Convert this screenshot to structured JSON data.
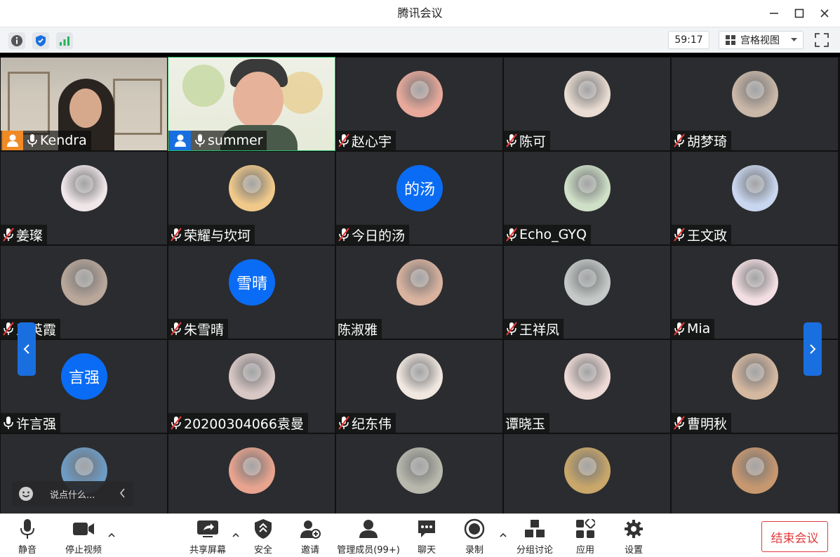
{
  "window": {
    "title": "腾讯会议"
  },
  "infobar": {
    "timer": "59:17",
    "view_mode": "宫格视图"
  },
  "participants": [
    {
      "name": "Kendra",
      "mic": "on",
      "video": true,
      "host": true
    },
    {
      "name": "summer",
      "mic": "on",
      "video": true,
      "cohost": true
    },
    {
      "name": "赵心宇",
      "mic": "muted",
      "avatar_color": "#e8a99a"
    },
    {
      "name": "陈可",
      "mic": "muted",
      "avatar_color": "#e9dcd2"
    },
    {
      "name": "胡梦琦",
      "mic": "muted",
      "avatar_color": "#c9b7a8"
    },
    {
      "name": "姜璨",
      "mic": "muted",
      "avatar_color": "#efe6e8"
    },
    {
      "name": "荣耀与坎坷",
      "mic": "muted",
      "avatar_color": "#f0c98a"
    },
    {
      "name": "今日的汤",
      "mic": "muted",
      "avatar_text": "的汤"
    },
    {
      "name": "Echo_GYQ",
      "mic": "muted",
      "avatar_color": "#cfe0c8"
    },
    {
      "name": "王文政",
      "mic": "muted",
      "avatar_color": "#c8d6ef"
    },
    {
      "name": "王英霞",
      "mic": "muted",
      "avatar_color": "#b9a79a"
    },
    {
      "name": "朱雪晴",
      "mic": "muted",
      "avatar_text": "雪晴"
    },
    {
      "name": "陈淑雅",
      "mic": "none",
      "avatar_color": "#d9b39f"
    },
    {
      "name": "王祥凤",
      "mic": "muted",
      "avatar_color": "#c4c9c7"
    },
    {
      "name": "Mia",
      "mic": "muted",
      "avatar_color": "#f3dfe3"
    },
    {
      "name": "许言强",
      "mic": "on",
      "avatar_text": "言强"
    },
    {
      "name": "20200304066袁曼",
      "mic": "muted",
      "avatar_color": "#d8c8c5"
    },
    {
      "name": "纪东伟",
      "mic": "muted",
      "avatar_color": "#f0e7e0"
    },
    {
      "name": "谭晓玉",
      "mic": "none",
      "avatar_color": "#eddad6"
    },
    {
      "name": "曹明秋",
      "mic": "muted",
      "avatar_color": "#d5b8a0"
    },
    {
      "name": "",
      "mic": "none",
      "avatar_color": "#6d9cc5"
    },
    {
      "name": "",
      "mic": "none",
      "avatar_color": "#e8a48f"
    },
    {
      "name": "",
      "mic": "none",
      "avatar_color": "#b8b8ad"
    },
    {
      "name": "",
      "mic": "none",
      "avatar_color": "#c9a76a"
    },
    {
      "name": "",
      "mic": "none",
      "avatar_color": "#c79870"
    }
  ],
  "chat": {
    "placeholder": "说点什么..."
  },
  "toolbar": {
    "mute": "静音",
    "stop_video": "停止视频",
    "share_screen": "共享屏幕",
    "security": "安全",
    "invite": "邀请",
    "manage_members": "管理成员(99+)",
    "chat": "聊天",
    "record": "录制",
    "breakout": "分组讨论",
    "apps": "应用",
    "settings": "设置",
    "end_meeting": "结束会议"
  },
  "colors": {
    "accent": "#0a6cf5",
    "danger": "#e03b3b",
    "tile": "#2b2c2f",
    "active_speaker": "#27c06a"
  }
}
